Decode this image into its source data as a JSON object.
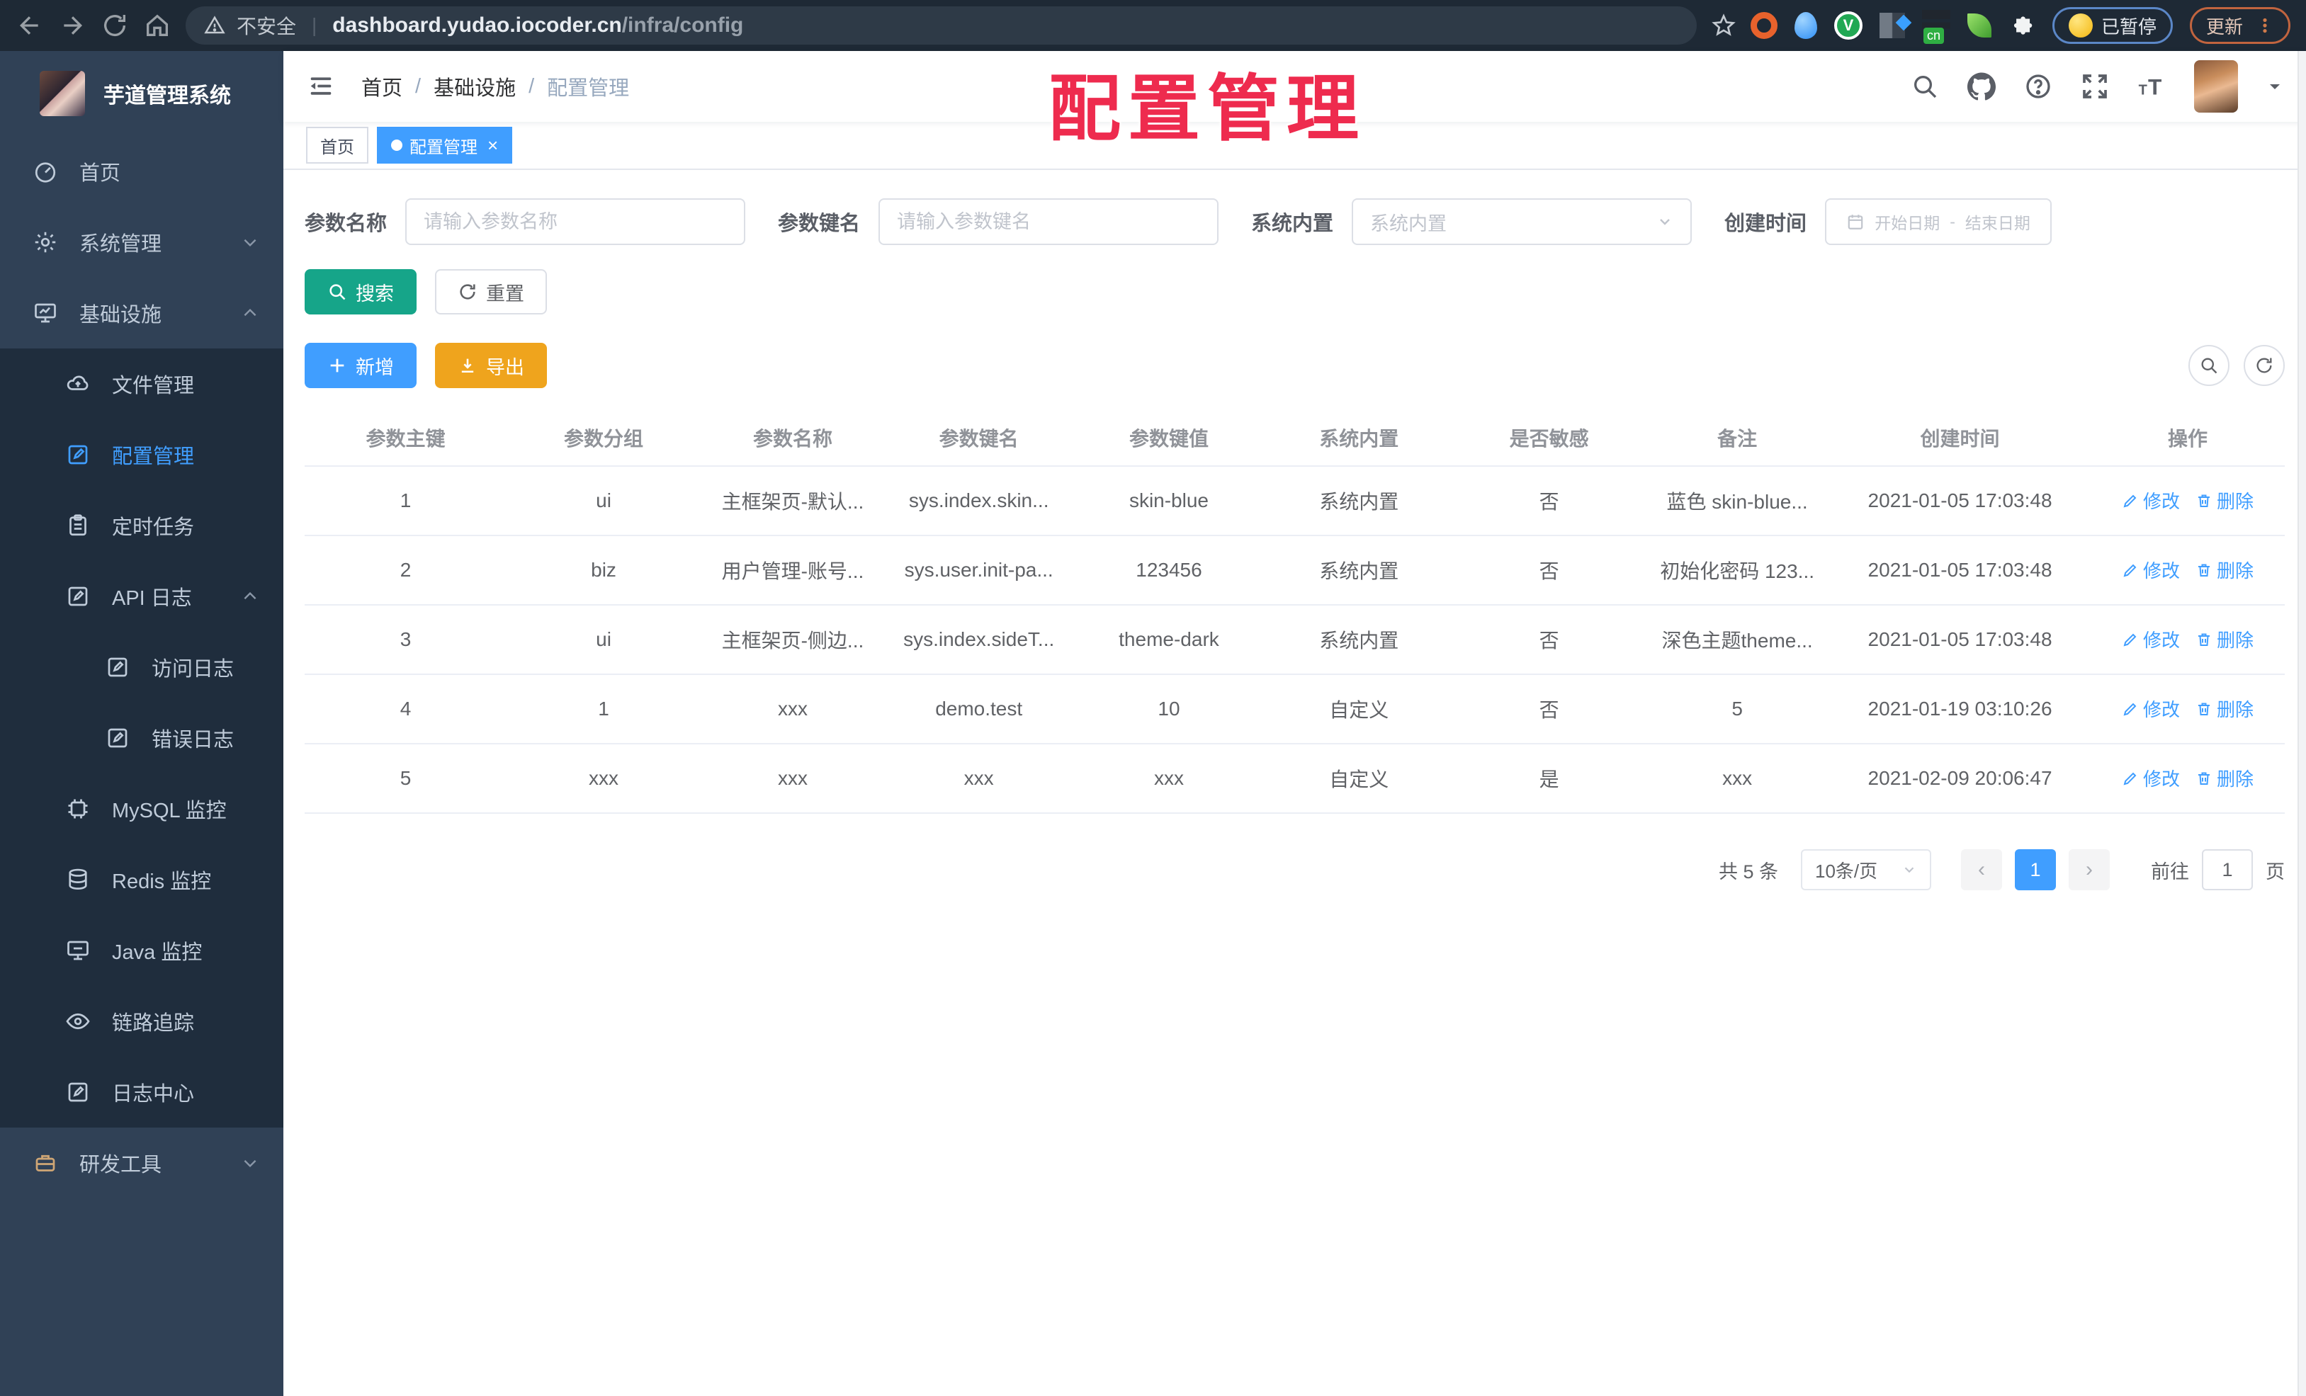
{
  "colors": {
    "accent": "#409EFF",
    "search_btn": "#16A589",
    "export_btn": "#EFA41D",
    "watermark": "#EE2B4E",
    "sidebar_bg": "#304156",
    "sidebar_sub_bg": "#1F2D3D"
  },
  "watermark": "配置管理",
  "browser": {
    "security_label": "不安全",
    "url_host": "dashboard.yudao.iocoder.cn",
    "url_path": "/infra/config",
    "paused_badge": "已暂停",
    "update_button": "更新",
    "ext_cn_label": "cn"
  },
  "sidebar": {
    "title": "芋道管理系统",
    "items": [
      {
        "label": "首页"
      },
      {
        "label": "系统管理"
      },
      {
        "label": "基础设施"
      },
      {
        "label": "文件管理"
      },
      {
        "label": "配置管理"
      },
      {
        "label": "定时任务"
      },
      {
        "label": "API 日志"
      },
      {
        "label": "访问日志"
      },
      {
        "label": "错误日志"
      },
      {
        "label": "MySQL 监控"
      },
      {
        "label": "Redis 监控"
      },
      {
        "label": "Java 监控"
      },
      {
        "label": "链路追踪"
      },
      {
        "label": "日志中心"
      },
      {
        "label": "研发工具"
      }
    ]
  },
  "breadcrumb": [
    "首页",
    "基础设施",
    "配置管理"
  ],
  "tags": {
    "home": "首页",
    "current": "配置管理"
  },
  "filters": {
    "name_label": "参数名称",
    "name_placeholder": "请输入参数名称",
    "key_label": "参数键名",
    "key_placeholder": "请输入参数键名",
    "type_label": "系统内置",
    "type_placeholder": "系统内置",
    "date_label": "创建时间",
    "date_start": "开始日期",
    "date_sep": "-",
    "date_end": "结束日期"
  },
  "actions": {
    "search": "搜索",
    "reset": "重置",
    "add": "新增",
    "export": "导出"
  },
  "table": {
    "columns": [
      "参数主键",
      "参数分组",
      "参数名称",
      "参数键名",
      "参数键值",
      "系统内置",
      "是否敏感",
      "备注",
      "创建时间",
      "操作"
    ],
    "edit_label": "修改",
    "delete_label": "删除",
    "rows": [
      [
        "1",
        "ui",
        "主框架页-默认...",
        "sys.index.skin...",
        "skin-blue",
        "系统内置",
        "否",
        "蓝色 skin-blue...",
        "2021-01-05 17:03:48"
      ],
      [
        "2",
        "biz",
        "用户管理-账号...",
        "sys.user.init-pa...",
        "123456",
        "系统内置",
        "否",
        "初始化密码 123...",
        "2021-01-05 17:03:48"
      ],
      [
        "3",
        "ui",
        "主框架页-侧边...",
        "sys.index.sideT...",
        "theme-dark",
        "系统内置",
        "否",
        "深色主题theme...",
        "2021-01-05 17:03:48"
      ],
      [
        "4",
        "1",
        "xxx",
        "demo.test",
        "10",
        "自定义",
        "否",
        "5",
        "2021-01-19 03:10:26"
      ],
      [
        "5",
        "xxx",
        "xxx",
        "xxx",
        "xxx",
        "自定义",
        "是",
        "xxx",
        "2021-02-09 20:06:47"
      ]
    ]
  },
  "pagination": {
    "total": "共 5 条",
    "page_size": "10条/页",
    "current_page": "1",
    "goto_label": "前往",
    "goto_value": "1",
    "page_unit": "页"
  }
}
